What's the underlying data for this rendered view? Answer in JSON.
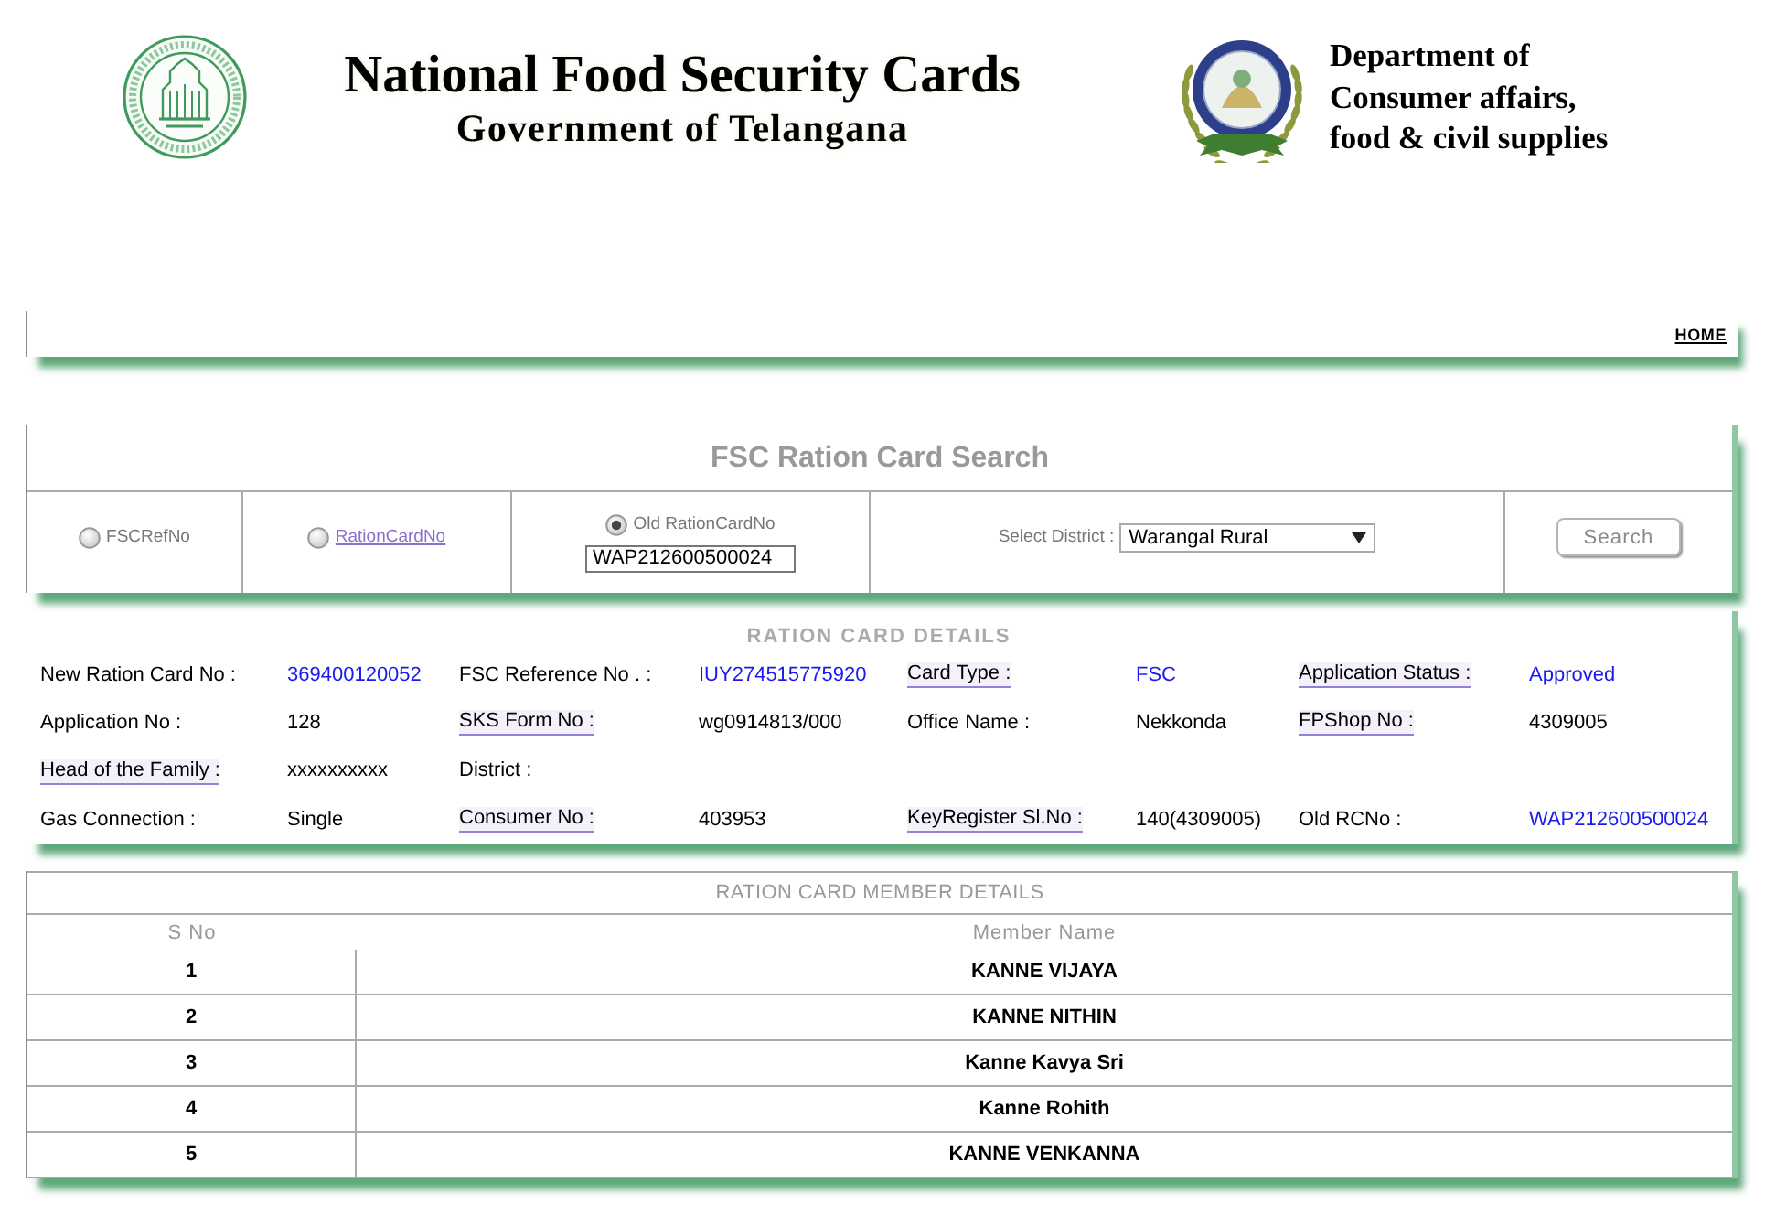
{
  "header": {
    "title": "National Food Security Cards",
    "subtitle": "Government of Telangana",
    "department": [
      "Department of",
      "Consumer affairs,",
      "food & civil supplies"
    ]
  },
  "nav": {
    "links": [
      {
        "label": "HOME"
      }
    ]
  },
  "search": {
    "title": "FSC Ration Card Search",
    "options": [
      {
        "label": "FSCRefNo",
        "kind": "text",
        "selected": false
      },
      {
        "label": "RationCardNo",
        "kind": "link",
        "selected": false
      },
      {
        "label": "Old RationCardNo",
        "kind": "text",
        "selected": true,
        "input_value": "WAP212600500024"
      }
    ],
    "district": {
      "label": "Select District :",
      "value": "Warangal Rural"
    },
    "button": "Search"
  },
  "details": {
    "heading": "RATION CARD DETAILS",
    "rows": [
      {
        "fields": [
          {
            "label": "New Ration Card No :",
            "underlined": false,
            "value": "369400120052",
            "highlighted": true
          },
          {
            "label": "FSC Reference No . :",
            "underlined": false,
            "value": "IUY274515775920",
            "highlighted": true
          },
          {
            "label": "Card Type :",
            "underlined": true,
            "value": "FSC",
            "highlighted": true
          },
          {
            "label": "Application Status :",
            "underlined": true,
            "value": "Approved",
            "highlighted": true
          }
        ]
      },
      {
        "fields": [
          {
            "label": "Application No :",
            "underlined": false,
            "value": "128",
            "highlighted": false
          },
          {
            "label": "SKS Form No :",
            "underlined": true,
            "value": "wg0914813/000",
            "highlighted": false
          },
          {
            "label": "Office Name :",
            "underlined": false,
            "value": "Nekkonda",
            "highlighted": false
          },
          {
            "label": "FPShop No :",
            "underlined": true,
            "value": "4309005",
            "highlighted": false
          }
        ]
      },
      {
        "fields": [
          {
            "label": "Head of the Family :",
            "underlined": true,
            "value": "xxxxxxxxxx",
            "highlighted": false
          },
          {
            "label": "District :",
            "underlined": false
          }
        ]
      },
      {
        "fields": [
          {
            "label": "Gas Connection :",
            "underlined": false,
            "value": "Single",
            "highlighted": false
          },
          {
            "label": "Consumer No :",
            "underlined": true,
            "value": "403953",
            "highlighted": false
          },
          {
            "label": "KeyRegister Sl.No :",
            "underlined": true,
            "value": "140(4309005)",
            "highlighted": false
          },
          {
            "label": "Old RCNo :",
            "underlined": false,
            "value": "WAP212600500024",
            "highlighted": true
          }
        ]
      }
    ]
  },
  "members": {
    "title": "RATION CARD MEMBER DETAILS",
    "columns": [
      "S No",
      "Member Name"
    ],
    "rows": [
      [
        "1",
        "KANNE VIJAYA"
      ],
      [
        "2",
        "KANNE NITHIN"
      ],
      [
        "3",
        "Kanne Kavya Sri"
      ],
      [
        "4",
        "Kanne Rohith"
      ],
      [
        "5",
        "KANNE VENKANNA"
      ]
    ]
  }
}
